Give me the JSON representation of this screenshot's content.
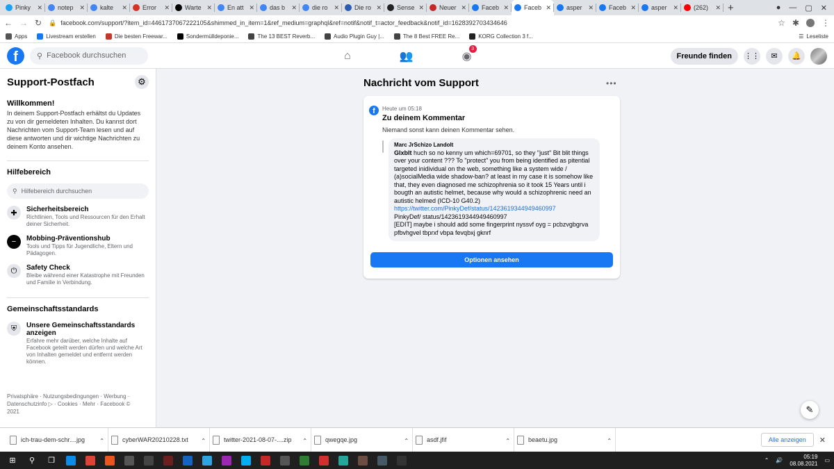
{
  "browser": {
    "tabs": [
      {
        "title": "Pinky",
        "color": "#1da1f2"
      },
      {
        "title": "notep",
        "color": "#4285f4"
      },
      {
        "title": "kalte",
        "color": "#4285f4"
      },
      {
        "title": "Error",
        "color": "#d93025"
      },
      {
        "title": "Warte",
        "color": "#000000"
      },
      {
        "title": "En att",
        "color": "#4285f4"
      },
      {
        "title": "das b",
        "color": "#4285f4"
      },
      {
        "title": "die ro",
        "color": "#4285f4"
      },
      {
        "title": "Die ro",
        "color": "#2a5db0"
      },
      {
        "title": "Sense",
        "color": "#222222"
      },
      {
        "title": "Neuer",
        "color": "#c62828"
      },
      {
        "title": "Faceb",
        "color": "#1877f2"
      },
      {
        "title": "Faceb",
        "color": "#1877f2",
        "active": true
      },
      {
        "title": "asper",
        "color": "#1877f2"
      },
      {
        "title": "Faceb",
        "color": "#1877f2"
      },
      {
        "title": "asper",
        "color": "#1877f2"
      },
      {
        "title": "(262)",
        "color": "#ff0000"
      }
    ],
    "url": "facebook.com/support/?item_id=4461737067222105&shimmed_in_item=1&ref_medium=graphql&ref=notif&notif_t=actor_feedback&notif_id=1628392703434646",
    "bookmarks": [
      {
        "label": "Apps",
        "color": "#555555"
      },
      {
        "label": "Livestream erstellen",
        "color": "#1877f2"
      },
      {
        "label": "Die besten Freewar...",
        "color": "#c0392b"
      },
      {
        "label": "Sondermülldeponie...",
        "color": "#000000"
      },
      {
        "label": "The 13 BEST Reverb...",
        "color": "#444444"
      },
      {
        "label": "Audio Plugin Guy |...",
        "color": "#444444"
      },
      {
        "label": "The 8 Best FREE Re...",
        "color": "#444444"
      },
      {
        "label": "KORG Collection 3 f...",
        "color": "#222222"
      }
    ],
    "reading_list": "Leseliste"
  },
  "fb_header": {
    "search_placeholder": "Facebook durchsuchen",
    "groups_badge": "3",
    "find_friends": "Freunde finden"
  },
  "sidebar": {
    "title": "Support-Postfach",
    "welcome_heading": "Willkommen!",
    "welcome_text": "In deinem Support-Postfach erhältst du Updates zu von dir gemeldeten Inhalten. Du kannst dort Nachrichten vom Support-Team lesen und auf diese antworten und dir wichtige Nachrichten zu deinem Konto ansehen.",
    "help_heading": "Hilfebereich",
    "help_search_placeholder": "Hilfebereich durchsuchen",
    "help_items": [
      {
        "title": "Sicherheitsbereich",
        "desc": "Richtlinien, Tools und Ressourcen für den Erhalt deiner Sicherheit.",
        "icon": "lifebuoy-icon"
      },
      {
        "title": "Mobbing-Präventionshub",
        "desc": "Tools und Tipps für Jugendliche, Eltern und Pädagogen.",
        "icon": "minus-circle-icon"
      },
      {
        "title": "Safety Check",
        "desc": "Bleibe während einer Katastrophe mit Freunden und Familie in Verbindung.",
        "icon": "power-icon"
      }
    ],
    "standards_heading": "Gemeinschaftsstandards",
    "standards_item": {
      "title": "Unsere Gemeinschaftsstandards anzeigen",
      "desc": "Erfahre mehr darüber, welche Inhalte auf Facebook geteilt werden dürfen und welche Art von Inhalten gemeldet und entfernt werden können.",
      "icon": "shield-icon"
    },
    "footer": "Privatsphäre · Nutzungsbedingungen · Werbung · Datenschutzinfo ▷ · Cookies · Mehr · Facebook © 2021"
  },
  "message": {
    "page_title": "Nachricht vom Support",
    "time": "Heute um 05:18",
    "subject": "Zu deinem Kommentar",
    "note": "Niemand sonst kann deinen Kommentar sehen.",
    "quote_author": "Marc JrSchizo Landolt",
    "quote_lead": "Glxblt",
    "quote_text": " huch so no kenny um which=69701, so they \"just\" Bit blit things over your content ??? To \"protect\" you from being identified as pitential targeted inidividual on the web, something like a system wide / (a)socialMedia wide shadow-ban? at least in my case it is somehow like that, they even diagnosed me schizophrenia so it took 15 Years until i bougth an autistic helmet, because why would a schizophrenic need an autistic helmed (ICD-10 G40.2)",
    "quote_link": "https://twitter.com/PinkyDef/status/1423619344949460997",
    "quote_after_link": "PinkyDef/ status/1423619344949460997",
    "quote_edit": "[EDIT] maybe i should add some fingerprint nyssvf oyg = pcbzvgbgrva pfbvhgvel tbprxf vbpa fevqbxj gknrf",
    "options_button": "Optionen ansehen"
  },
  "downloads": {
    "items": [
      "ich-trau-dem-schr....jpg",
      "cyberWAR20210228.txt",
      "twitter-2021-08-07-....zip",
      "qwegqe.jpg",
      "asdf.jfif",
      "beaetu.jpg"
    ],
    "show_all": "Alle anzeigen"
  },
  "taskbar": {
    "time": "05:19",
    "date": "08.08.2021",
    "apps": [
      {
        "name": "search",
        "color": "#1f1f1f"
      },
      {
        "name": "task-view",
        "color": "#1f1f1f"
      },
      {
        "name": "edge",
        "color": "#0c8ce9"
      },
      {
        "name": "chrome",
        "color": "#db4437"
      },
      {
        "name": "ubuntu",
        "color": "#e95420"
      },
      {
        "name": "app",
        "color": "#555555"
      },
      {
        "name": "inkscape",
        "color": "#444444"
      },
      {
        "name": "live",
        "color": "#6b1f1f"
      },
      {
        "name": "app",
        "color": "#1565c0"
      },
      {
        "name": "telegram",
        "color": "#2ca5e0"
      },
      {
        "name": "app",
        "color": "#9c27b0"
      },
      {
        "name": "skype",
        "color": "#00aff0"
      },
      {
        "name": "app",
        "color": "#c62828"
      },
      {
        "name": "app",
        "color": "#555555"
      },
      {
        "name": "app",
        "color": "#2e7d32"
      },
      {
        "name": "app",
        "color": "#d32f2f"
      },
      {
        "name": "app",
        "color": "#26a69a"
      },
      {
        "name": "app",
        "color": "#6d4c41"
      },
      {
        "name": "app",
        "color": "#455a64"
      },
      {
        "name": "terminal",
        "color": "#333333"
      }
    ]
  }
}
